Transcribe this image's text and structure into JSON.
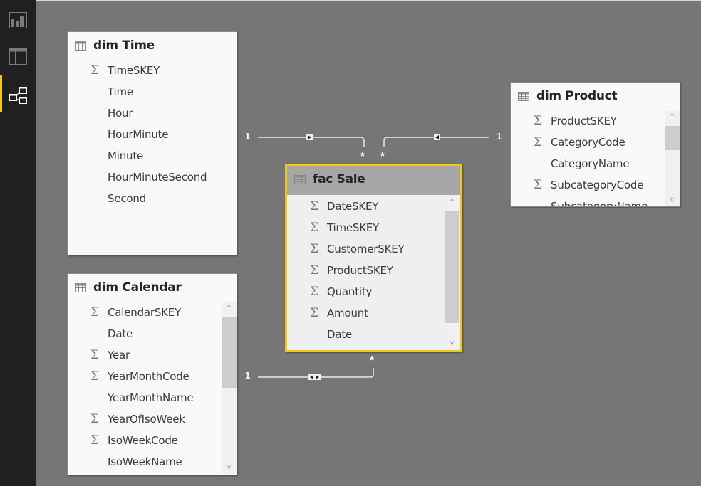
{
  "app": {
    "view": "Relationships"
  },
  "sidebar": {
    "items": [
      {
        "name": "report-view",
        "icon": "bar-chart-icon",
        "active": false
      },
      {
        "name": "data-view",
        "icon": "table-grid-icon",
        "active": false
      },
      {
        "name": "relationships-view",
        "icon": "model-diagram-icon",
        "active": true
      }
    ],
    "accent": "#f2c811"
  },
  "tables": {
    "dim_time": {
      "title": "dim Time",
      "fields": [
        {
          "name": "TimeSKEY",
          "sigma": true
        },
        {
          "name": "Time",
          "sigma": false
        },
        {
          "name": "Hour",
          "sigma": false
        },
        {
          "name": "HourMinute",
          "sigma": false
        },
        {
          "name": "Minute",
          "sigma": false
        },
        {
          "name": "HourMinuteSecond",
          "sigma": false
        },
        {
          "name": "Second",
          "sigma": false
        }
      ]
    },
    "dim_calendar": {
      "title": "dim Calendar",
      "fields": [
        {
          "name": "CalendarSKEY",
          "sigma": true
        },
        {
          "name": "Date",
          "sigma": false
        },
        {
          "name": "Year",
          "sigma": true
        },
        {
          "name": "YearMonthCode",
          "sigma": true
        },
        {
          "name": "YearMonthName",
          "sigma": false
        },
        {
          "name": "YearOfIsoWeek",
          "sigma": true
        },
        {
          "name": "IsoWeekCode",
          "sigma": true
        },
        {
          "name": "IsoWeekName",
          "sigma": false
        }
      ]
    },
    "fac_sale": {
      "title": "fac Sale",
      "selected": true,
      "fields": [
        {
          "name": "DateSKEY",
          "sigma": true
        },
        {
          "name": "TimeSKEY",
          "sigma": true
        },
        {
          "name": "CustomerSKEY",
          "sigma": true
        },
        {
          "name": "ProductSKEY",
          "sigma": true
        },
        {
          "name": "Quantity",
          "sigma": true
        },
        {
          "name": "Amount",
          "sigma": true
        },
        {
          "name": "Date",
          "sigma": false
        }
      ]
    },
    "dim_product": {
      "title": "dim Product",
      "fields": [
        {
          "name": "ProductSKEY",
          "sigma": true
        },
        {
          "name": "CategoryCode",
          "sigma": true
        },
        {
          "name": "CategoryName",
          "sigma": false
        },
        {
          "name": "SubcategoryCode",
          "sigma": true
        },
        {
          "name": "SubcategoryName",
          "sigma": false
        }
      ]
    }
  },
  "relationships": [
    {
      "from": "dim Time",
      "to": "fac Sale",
      "one_label": "1",
      "many_label": "*",
      "direction": "single"
    },
    {
      "from": "dim Product",
      "to": "fac Sale",
      "one_label": "1",
      "many_label": "*",
      "direction": "single"
    },
    {
      "from": "dim Calendar",
      "to": "fac Sale",
      "one_label": "1",
      "many_label": "*",
      "direction": "both"
    }
  ],
  "scroll_icons": {
    "up": "chevron-up-icon",
    "down": "chevron-down-icon"
  },
  "glyphs": {
    "sigma": "Σ",
    "up": "^",
    "down": "v"
  }
}
